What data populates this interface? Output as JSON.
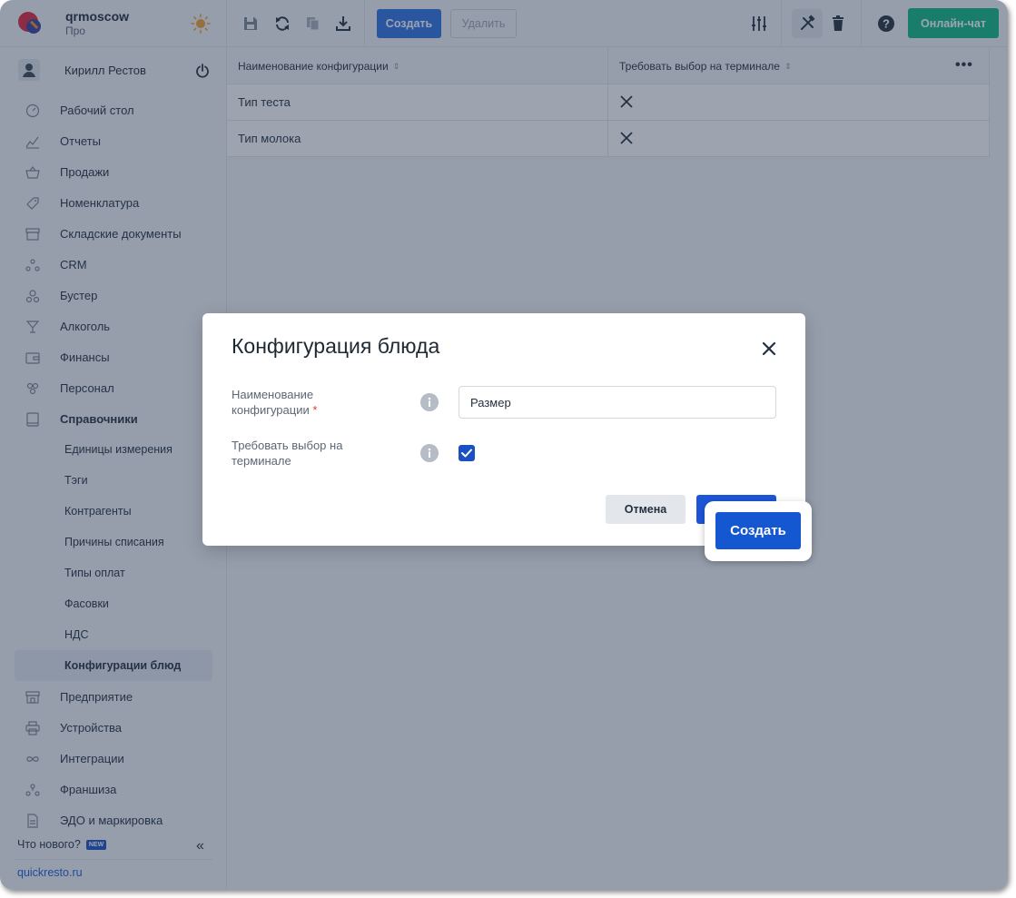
{
  "brand": {
    "name": "qrmoscow",
    "plan": "Про"
  },
  "user": {
    "name": "Кирилл Рестов"
  },
  "sidebar": {
    "items": [
      {
        "label": "Рабочий стол",
        "icon": "gauge-icon"
      },
      {
        "label": "Отчеты",
        "icon": "chart-icon"
      },
      {
        "label": "Продажи",
        "icon": "basket-icon"
      },
      {
        "label": "Номенклатура",
        "icon": "tag-icon"
      },
      {
        "label": "Складские документы",
        "icon": "archive-icon"
      },
      {
        "label": "CRM",
        "icon": "people-icon"
      },
      {
        "label": "Бустер",
        "icon": "booster-icon"
      },
      {
        "label": "Алкоголь",
        "icon": "glass-icon"
      },
      {
        "label": "Финансы",
        "icon": "wallet-icon"
      },
      {
        "label": "Персонал",
        "icon": "staff-icon"
      },
      {
        "label": "Справочники",
        "icon": "book-icon"
      }
    ],
    "sub_items": [
      "Единицы измерения",
      "Тэги",
      "Контрагенты",
      "Причины списания",
      "Типы оплат",
      "Фасовки",
      "НДС",
      "Конфигурации блюд"
    ],
    "items_after": [
      {
        "label": "Предприятие",
        "icon": "store-icon"
      },
      {
        "label": "Устройства",
        "icon": "printer-icon"
      },
      {
        "label": "Интеграции",
        "icon": "infinity-icon"
      },
      {
        "label": "Франшиза",
        "icon": "franchise-icon"
      },
      {
        "label": "ЭДО и маркировка",
        "icon": "document-icon"
      }
    ],
    "whats_new": "Что нового?",
    "new_badge": "NEW",
    "site": "quickresto.ru"
  },
  "toolbar": {
    "create_label": "Создать",
    "delete_label": "Удалить",
    "chat_label": "Онлайн-чат"
  },
  "table": {
    "columns": [
      "Наименование конфигурации",
      "Требовать выбор на терминале"
    ],
    "rows": [
      {
        "name": "Тип теста",
        "require": false
      },
      {
        "name": "Тип молока",
        "require": false
      }
    ]
  },
  "modal": {
    "title": "Конфигурация блюда",
    "name_label": "Наименование конфигурации",
    "name_required_mark": "*",
    "name_value": "Размер",
    "require_label": "Требовать выбор на терминале",
    "require_checked": true,
    "cancel_label": "Отмена",
    "create_label": "Создать"
  },
  "colors": {
    "accent": "#1556d1",
    "chat": "#10b981",
    "overlay": "#253550"
  }
}
